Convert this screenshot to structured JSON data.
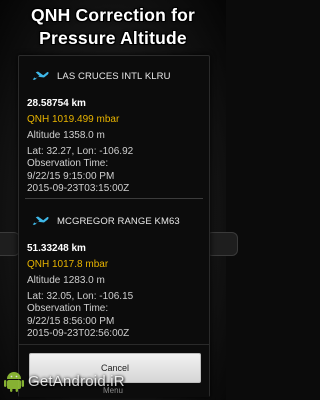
{
  "header": {
    "title_line1": "QNH Correction for",
    "title_line2": "Pressure Altitude"
  },
  "stations": [
    {
      "icon": "airplane-icon",
      "name": "LAS CRUCES INTL KLRU",
      "distance": "28.58754 km",
      "qnh": "QNH 1019.499 mbar",
      "altitude": "Altitude 1358.0 m",
      "latlon": "Lat: 32.27, Lon: -106.92",
      "obs_label": "Observation Time:",
      "obs_local": "9/22/15 9:15:00 PM",
      "obs_utc": "2015-09-23T03:15:00Z"
    },
    {
      "icon": "airplane-icon",
      "name": "MCGREGOR RANGE KM63",
      "distance": "51.33248 km",
      "qnh": "QNH 1017.8 mbar",
      "altitude": "Altitude 1283.0 m",
      "latlon": "Lat: 32.05, Lon: -106.15",
      "obs_label": "Observation Time:",
      "obs_local": "9/22/15 8:56:00 PM",
      "obs_utc": "2015-09-23T02:56:00Z"
    }
  ],
  "dialog": {
    "cancel_label": "Cancel"
  },
  "menu_hint": "Menu",
  "watermark": {
    "text": "GetAndroid.iR"
  },
  "colors": {
    "qnh": "#e8b400",
    "accent_icon": "#3fb8e8"
  }
}
